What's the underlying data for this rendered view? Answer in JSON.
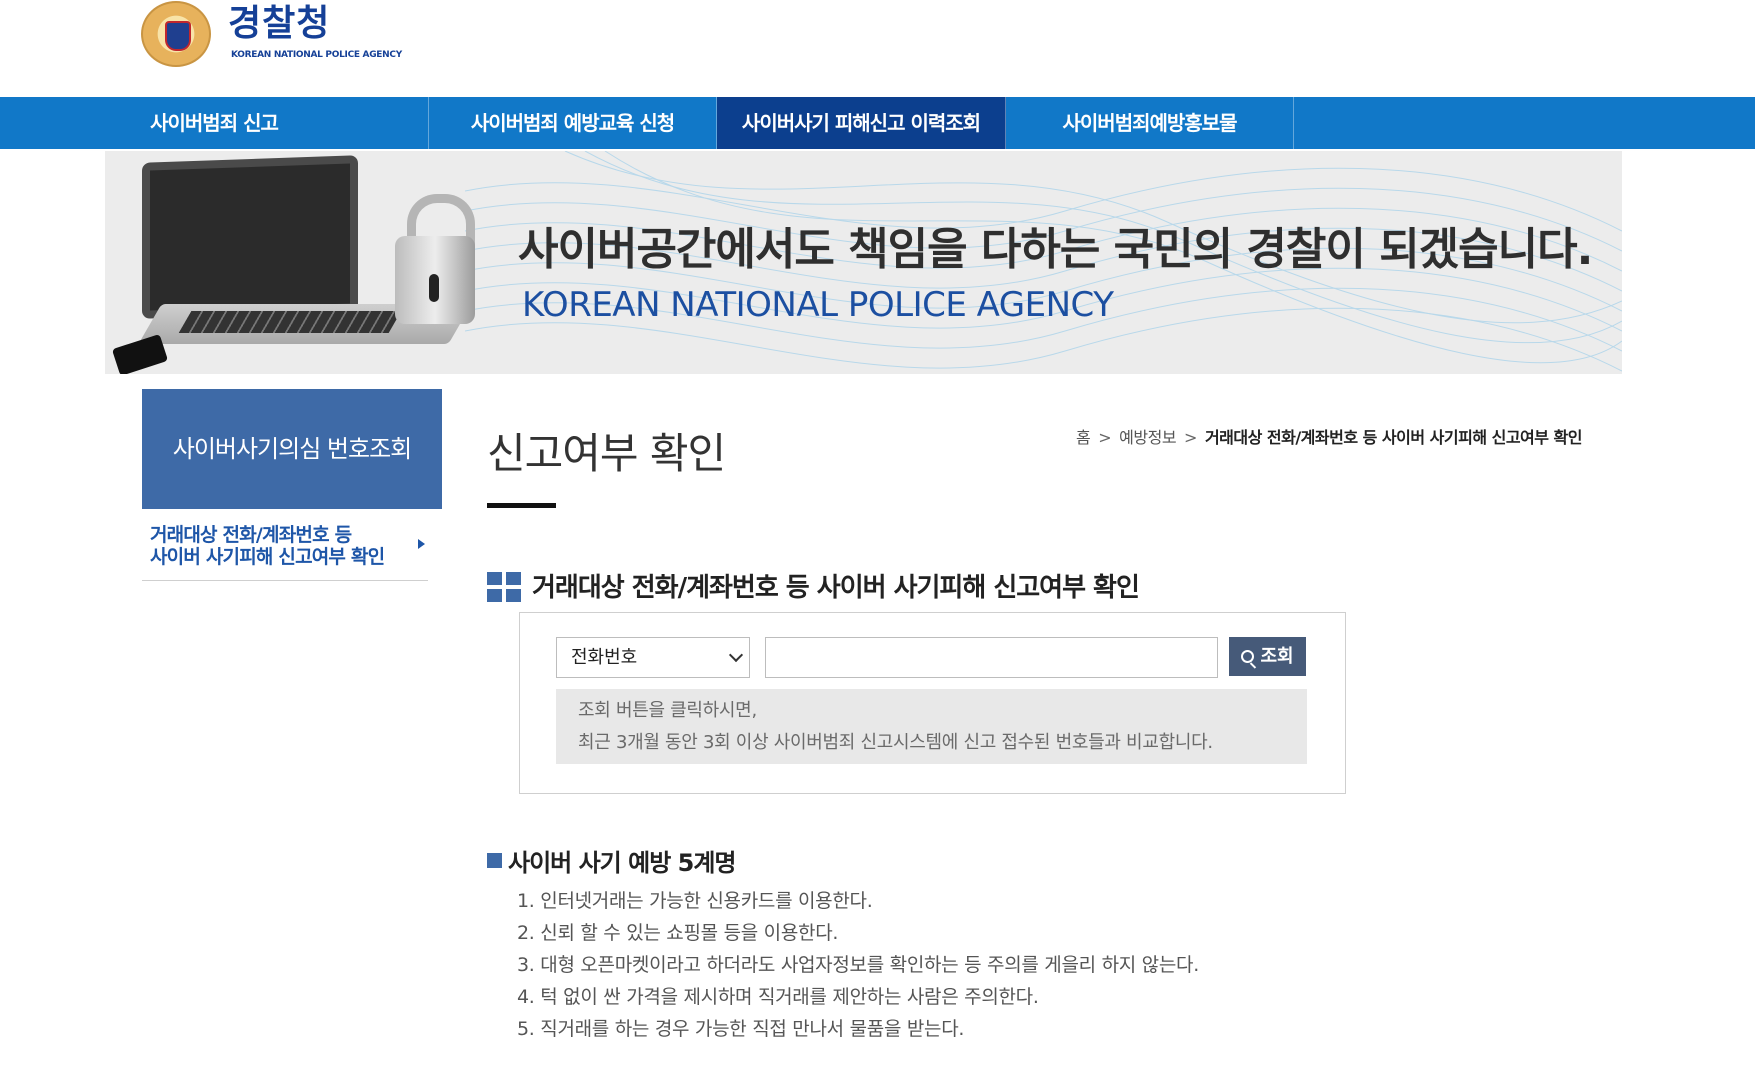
{
  "header": {
    "logo_kr": "경찰청",
    "logo_en": "KOREAN NATIONAL POLICE AGENCY"
  },
  "nav": {
    "items": [
      {
        "label": "사이버범죄 신고"
      },
      {
        "label": "사이버범죄 예방교육 신청"
      },
      {
        "label": "사이버사기 피해신고 이력조회",
        "active": true
      },
      {
        "label": "사이버범죄예방홍보물"
      }
    ],
    "color": "#1178c8",
    "active_color": "#0c3f8e"
  },
  "banner": {
    "title": "사이버공간에서도 책임을 다하는 국민의 경찰이 되겠습니다.",
    "subtitle": "KOREAN NATIONAL POLICE AGENCY"
  },
  "sidebar": {
    "title": "사이버사기의심 번호조회",
    "link_line1": "거래대상 전화/계좌번호 등",
    "link_line2": "사이버 사기피해 신고여부 확인"
  },
  "page": {
    "title": "신고여부 확인",
    "breadcrumb": {
      "home": "홈",
      "level1": "예방정보",
      "current": "거래대상 전화/계좌번호 등 사이버 사기피해 신고여부 확인"
    }
  },
  "search": {
    "heading": "거래대상 전화/계좌번호 등 사이버 사기피해 신고여부 확인",
    "select_value": "전화번호",
    "input_value": "",
    "button_label": "조회",
    "notice_line1": "조회 버튼을 클릭하시면,",
    "notice_line2": "최근 3개월 동안 3회 이상 사이버범죄 신고시스템에 신고 접수된 번호들과 비교합니다."
  },
  "tips": {
    "title": "사이버 사기 예방 5계명",
    "items": [
      "1. 인터넷거래는 가능한 신용카드를 이용한다.",
      "2. 신뢰 할 수 있는 쇼핑몰 등을 이용한다.",
      "3. 대형 오픈마켓이라고 하더라도 사업자정보를 확인하는 등 주의를 게을리 하지 않는다.",
      "4. 턱 없이 싼 가격을 제시하며 직거래를 제안하는 사람은 주의한다.",
      "5. 직거래를 하는 경우 가능한 직접 만나서 물품을 받는다."
    ]
  }
}
